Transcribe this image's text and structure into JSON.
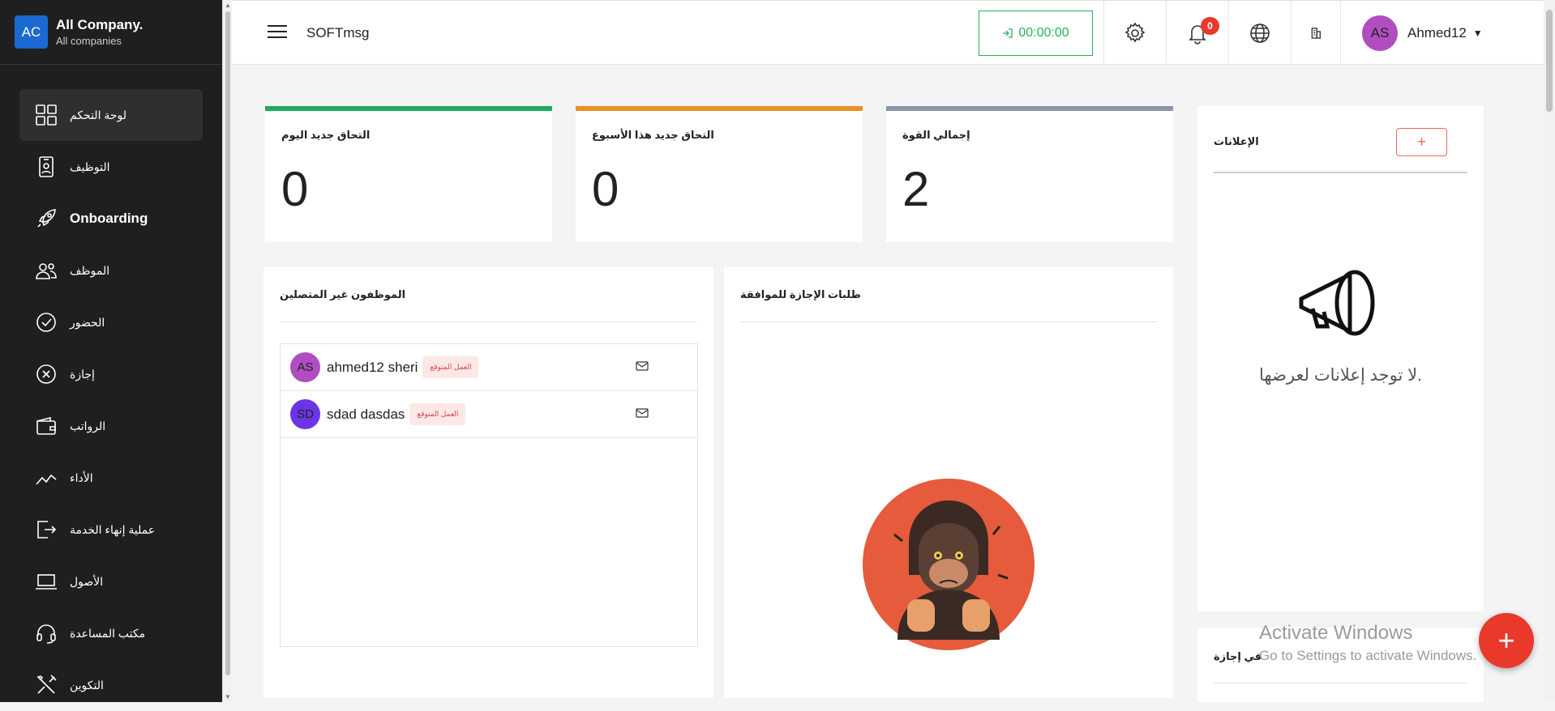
{
  "brand": {
    "logo": "AC",
    "name": "All Company.",
    "sub": "All companies"
  },
  "sidebar": {
    "items": [
      {
        "label": "لوحة التحكم",
        "icon": "dashboard-icon"
      },
      {
        "label": "التوظيف",
        "icon": "badge-icon"
      },
      {
        "label": "Onboarding",
        "icon": "rocket-icon"
      },
      {
        "label": "الموظف",
        "icon": "users-icon"
      },
      {
        "label": "الحضور",
        "icon": "check-circle-icon"
      },
      {
        "label": "إجازة",
        "icon": "x-circle-icon"
      },
      {
        "label": "الرواتب",
        "icon": "wallet-icon"
      },
      {
        "label": "الأداء",
        "icon": "chart-line-icon"
      },
      {
        "label": "عملية إنهاء الخدمة",
        "icon": "exit-icon"
      },
      {
        "label": "الأصول",
        "icon": "laptop-icon"
      },
      {
        "label": "مكتب المساعدة",
        "icon": "headset-icon"
      },
      {
        "label": "التكوين",
        "icon": "tools-icon"
      }
    ]
  },
  "header": {
    "app_title": "SOFTmsg",
    "timer": "00:00:00",
    "notifications_count": "0",
    "user_initials": "AS",
    "user_name": "Ahmed12"
  },
  "stats": [
    {
      "label": "التحاق جديد اليوم",
      "value": "0",
      "color": "#1fab5e"
    },
    {
      "label": "التحاق جديد هذا الأسبوع",
      "value": "0",
      "color": "#e8921f"
    },
    {
      "label": "إجمالي القوة",
      "value": "2",
      "color": "#8b95a8"
    }
  ],
  "offline_employees": {
    "title": "الموظفون غير المتصلين",
    "rows": [
      {
        "initials": "AS",
        "name": "ahmed12 sheri",
        "tag": "العمل المتوقع",
        "color": "#b04ec1"
      },
      {
        "initials": "SD",
        "name": "sdad dasdas",
        "tag": "العمل المتوقع",
        "color": "#6a35e6"
      }
    ]
  },
  "leave_requests": {
    "title": "طلبات الإجازة للموافقة"
  },
  "announcements": {
    "title": "الإعلانات",
    "add": "+",
    "empty": "لا توجد إعلانات لعرضها."
  },
  "on_leave": {
    "title": "في إجازة"
  },
  "watermark": {
    "line1": "Activate Windows",
    "line2": "Go to Settings to activate Windows."
  },
  "fab": "+"
}
